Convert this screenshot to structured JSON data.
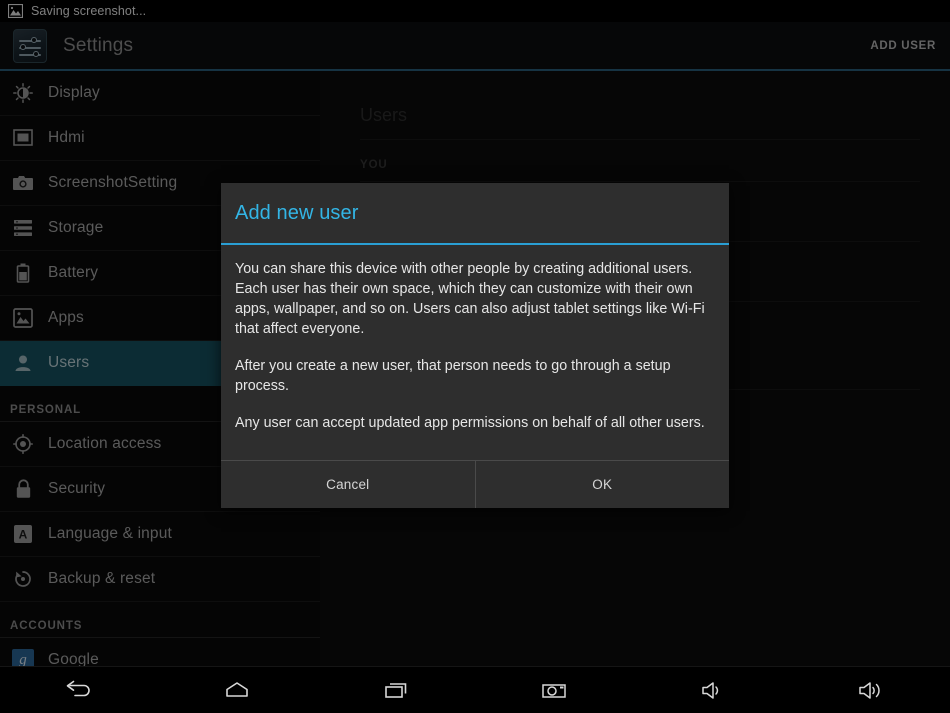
{
  "statusbar": {
    "icon": "image-icon",
    "text": "Saving screenshot..."
  },
  "actionbar": {
    "app_icon": "settings-sliders-icon",
    "title": "Settings",
    "add_user_label": "ADD USER",
    "accent_color": "#33b5e5"
  },
  "sidebar": {
    "selected_color": "#17505f",
    "items": [
      {
        "label": "Display",
        "icon": "brightness-icon",
        "type": "item"
      },
      {
        "label": "Hdmi",
        "icon": "monitor-icon",
        "type": "item"
      },
      {
        "label": "ScreenshotSetting",
        "icon": "camera-icon",
        "type": "item"
      },
      {
        "label": "Storage",
        "icon": "storage-icon",
        "type": "item"
      },
      {
        "label": "Battery",
        "icon": "battery-icon",
        "type": "item"
      },
      {
        "label": "Apps",
        "icon": "apps-image-icon",
        "type": "item"
      },
      {
        "label": "Users",
        "icon": "person-icon",
        "type": "item",
        "selected": true
      },
      {
        "label": "PERSONAL",
        "icon": "",
        "type": "header"
      },
      {
        "label": "Location access",
        "icon": "location-icon",
        "type": "item"
      },
      {
        "label": "Security",
        "icon": "lock-icon",
        "type": "item"
      },
      {
        "label": "Language & input",
        "icon": "language-a-icon",
        "type": "item"
      },
      {
        "label": "Backup & reset",
        "icon": "backup-reset-icon",
        "type": "item"
      },
      {
        "label": "ACCOUNTS",
        "icon": "",
        "type": "header"
      },
      {
        "label": "Google",
        "icon": "google-g-icon",
        "type": "item"
      }
    ]
  },
  "content": {
    "title": "Users",
    "section_you": "YOU"
  },
  "dialog": {
    "title": "Add new user",
    "paragraphs": [
      "You can share this device with other people by creating additional users. Each user has their own space, which they can customize with their own apps, wallpaper, and so on. Users can also adjust tablet settings like Wi-Fi that affect everyone.",
      "After you create a new user, that person needs to go through a setup process.",
      "Any user can accept updated app permissions on behalf of all other users."
    ],
    "cancel_label": "Cancel",
    "ok_label": "OK"
  },
  "navbar": {
    "buttons": [
      {
        "name": "back-icon"
      },
      {
        "name": "home-icon"
      },
      {
        "name": "recents-icon"
      },
      {
        "name": "screenshot-camera-icon"
      },
      {
        "name": "volume-down-icon"
      },
      {
        "name": "volume-up-icon"
      }
    ]
  }
}
